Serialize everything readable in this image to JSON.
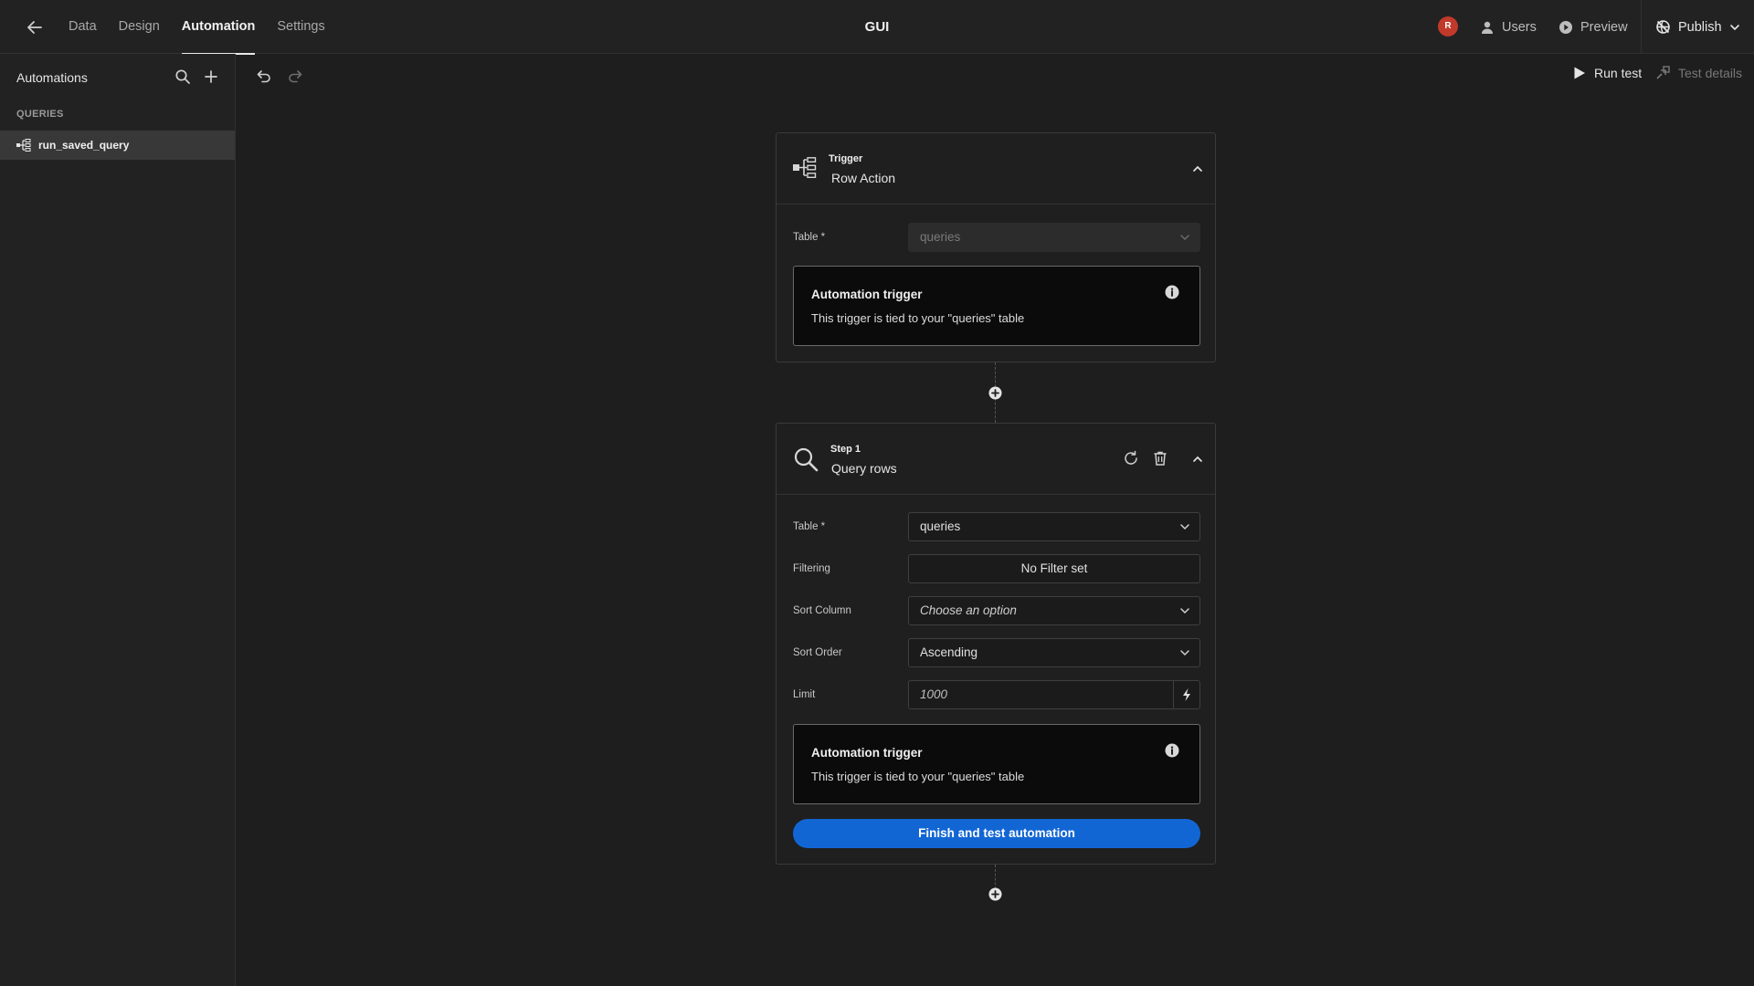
{
  "app": {
    "title": "GUI"
  },
  "nav": {
    "tabs": [
      {
        "label": "Data"
      },
      {
        "label": "Design"
      },
      {
        "label": "Automation",
        "active": true
      },
      {
        "label": "Settings"
      }
    ]
  },
  "header": {
    "avatar_initial": "R",
    "users_label": "Users",
    "preview_label": "Preview",
    "publish_label": "Publish"
  },
  "sidebar": {
    "title": "Automations",
    "section": "QUERIES",
    "items": [
      {
        "label": "run_saved_query",
        "selected": true
      }
    ]
  },
  "toolbar": {
    "run_test_label": "Run test",
    "test_details_label": "Test details"
  },
  "trigger": {
    "kicker": "Trigger",
    "name": "Row Action",
    "table_label": "Table *",
    "table_value": "queries",
    "info_title": "Automation trigger",
    "info_text": "This trigger is tied to your \"queries\" table"
  },
  "step": {
    "kicker": "Step 1",
    "name": "Query rows",
    "fields": {
      "table": {
        "label": "Table *",
        "value": "queries"
      },
      "filtering": {
        "label": "Filtering",
        "value": "No Filter set"
      },
      "sort_column": {
        "label": "Sort Column",
        "placeholder": "Choose an option"
      },
      "sort_order": {
        "label": "Sort Order",
        "value": "Ascending"
      },
      "limit": {
        "label": "Limit",
        "placeholder": "1000"
      }
    },
    "info_title": "Automation trigger",
    "info_text": "This trigger is tied to your \"queries\" table",
    "finish_label": "Finish and test automation"
  },
  "colors": {
    "accent": "#1266d4",
    "avatar": "#c0392b",
    "background": "#1e1e1e"
  },
  "icons": {
    "back": "arrow-left-icon",
    "users": "user-icon",
    "preview": "play-circle-icon",
    "publish": "globe-strike-icon",
    "trigger": "tree-structure-icon",
    "step": "magnifier-icon"
  }
}
